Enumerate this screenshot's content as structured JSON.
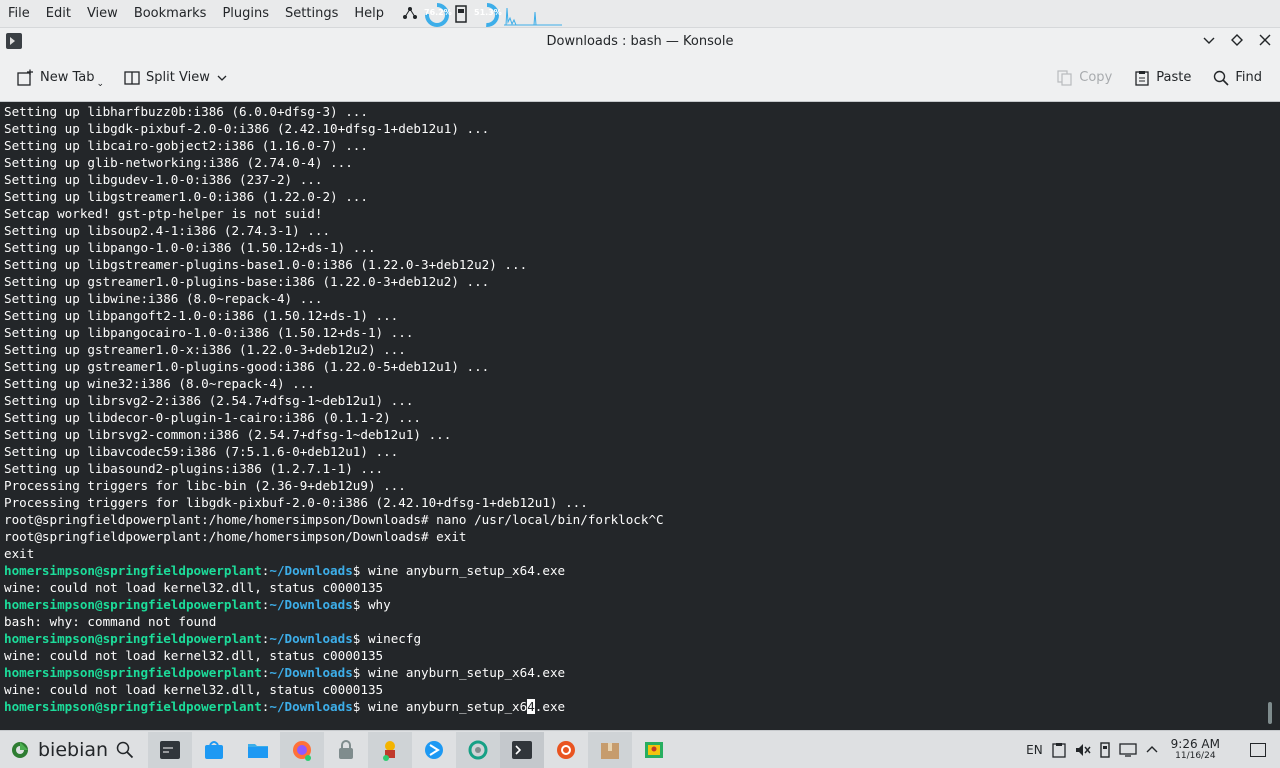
{
  "menubar": {
    "items": [
      "File",
      "Edit",
      "View",
      "Bookmarks",
      "Plugins",
      "Settings",
      "Help"
    ],
    "cpu_gauge": "76.2%",
    "mem_gauge": "51.3%"
  },
  "window": {
    "title": "Downloads : bash — Konsole"
  },
  "toolbar": {
    "new_tab": "New Tab",
    "split_view": "Split View",
    "copy": "Copy",
    "paste": "Paste",
    "find": "Find"
  },
  "terminal": {
    "lines": [
      "Setting up libharfbuzz0b:i386 (6.0.0+dfsg-3) ...",
      "Setting up libgdk-pixbuf-2.0-0:i386 (2.42.10+dfsg-1+deb12u1) ...",
      "Setting up libcairo-gobject2:i386 (1.16.0-7) ...",
      "Setting up glib-networking:i386 (2.74.0-4) ...",
      "Setting up libgudev-1.0-0:i386 (237-2) ...",
      "Setting up libgstreamer1.0-0:i386 (1.22.0-2) ...",
      "Setcap worked! gst-ptp-helper is not suid!",
      "Setting up libsoup2.4-1:i386 (2.74.3-1) ...",
      "Setting up libpango-1.0-0:i386 (1.50.12+ds-1) ...",
      "Setting up libgstreamer-plugins-base1.0-0:i386 (1.22.0-3+deb12u2) ...",
      "Setting up gstreamer1.0-plugins-base:i386 (1.22.0-3+deb12u2) ...",
      "Setting up libwine:i386 (8.0~repack-4) ...",
      "Setting up libpangoft2-1.0-0:i386 (1.50.12+ds-1) ...",
      "Setting up libpangocairo-1.0-0:i386 (1.50.12+ds-1) ...",
      "Setting up gstreamer1.0-x:i386 (1.22.0-3+deb12u2) ...",
      "Setting up gstreamer1.0-plugins-good:i386 (1.22.0-5+deb12u1) ...",
      "Setting up wine32:i386 (8.0~repack-4) ...",
      "Setting up librsvg2-2:i386 (2.54.7+dfsg-1~deb12u1) ...",
      "Setting up libdecor-0-plugin-1-cairo:i386 (0.1.1-2) ...",
      "Setting up librsvg2-common:i386 (2.54.7+dfsg-1~deb12u1) ...",
      "Setting up libavcodec59:i386 (7:5.1.6-0+deb12u1) ...",
      "Setting up libasound2-plugins:i386 (1.2.7.1-1) ...",
      "Processing triggers for libc-bin (2.36-9+deb12u9) ...",
      "Processing triggers for libgdk-pixbuf-2.0-0:i386 (2.42.10+dfsg-1+deb12u1) ...",
      "root@springfieldpowerplant:/home/homersimpson/Downloads# nano /usr/local/bin/forklock^C",
      "root@springfieldpowerplant:/home/homersimpson/Downloads# exit",
      "exit"
    ],
    "prompt_user": "homersimpson@springfieldpowerplant",
    "prompt_sep": ":",
    "prompt_path": "~/Downloads",
    "prompt_end": "$ ",
    "session": [
      {
        "cmd": "wine anyburn_setup_x64.exe",
        "out": "wine: could not load kernel32.dll, status c0000135"
      },
      {
        "cmd": "why",
        "out": "bash: why: command not found"
      },
      {
        "cmd": "winecfg",
        "out": "wine: could not load kernel32.dll, status c0000135"
      },
      {
        "cmd": "wine anyburn_setup_x64.exe",
        "out": "wine: could not load kernel32.dll, status c0000135"
      }
    ],
    "current_cmd_before": "wine anyburn_setup_x6",
    "current_cmd_cursor": "4",
    "current_cmd_after": ".exe"
  },
  "taskbar": {
    "launcher_label": "biebian",
    "lang": "EN",
    "time": "9:26 AM",
    "date": "11/16/24"
  }
}
